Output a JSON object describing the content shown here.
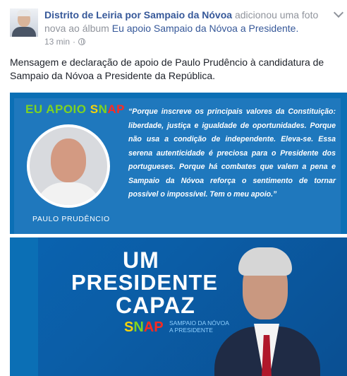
{
  "post": {
    "author": "Distrito de Leiria por Sampaio da Nóvoa",
    "action": " adicionou uma foto nova ao álbum ",
    "album": "Eu apoio Sampaio da Nóvoa a Presidente.",
    "time": "13 min",
    "separator": "·",
    "message": "Mensagem e declaração de apoio de Paulo Prudêncio à candidatura de Sampaio da Nóvoa a Presidente da República."
  },
  "photo1": {
    "eu_apoio": "EU APOIO ",
    "snap": [
      "S",
      "N",
      "A",
      "P"
    ],
    "person_name": "PAULO PRUDÊNCIO",
    "quote": "“Porque inscreve os principais valores da Constituição: liberdade, justiça e igualdade de oportunidades. Porque não usa a condição de independente. Eleva-se. Essa serena autenticidade é preciosa para o Presidente dos portugueses. Porque há combates que valem a pena e Sampaio da Nóvoa reforça o sentimento de tornar possível o impossível. Tem o meu apoio.”"
  },
  "photo2": {
    "line1": "UM",
    "line2": "PRESIDENTE",
    "line3": "CAPAZ",
    "snap": [
      "S",
      "N",
      "A",
      "P"
    ],
    "sub1": "SAMPAIO DA NÓVOA",
    "sub2": "A PRESIDENTE"
  },
  "colors": {
    "link": "#365899",
    "meta": "#90949c",
    "brand_blue": "#0b6fb5",
    "snap_yellow": "#f5d20a",
    "snap_green": "#7ed321",
    "snap_red": "#ff2a20"
  },
  "icons": [
    "avatar",
    "globe-icon",
    "chevron-down-icon"
  ]
}
